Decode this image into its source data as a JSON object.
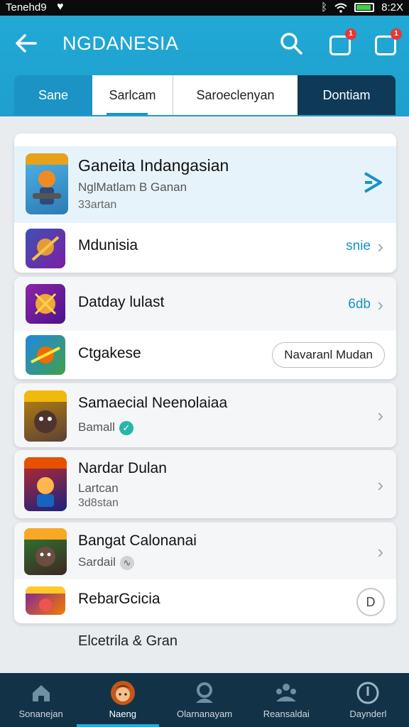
{
  "status_bar": {
    "carrier": "Tenehd9",
    "time": "8:2X"
  },
  "header": {
    "title": "NGDANESIA",
    "badge1": "1",
    "badge2": "1"
  },
  "tabs": [
    {
      "label": "Sane"
    },
    {
      "label": "Sarlcam"
    },
    {
      "label": "Saroeclenyan"
    },
    {
      "label": "Dontiam"
    }
  ],
  "cards": {
    "c1": {
      "r1": {
        "title": "Ganeita Indangasian",
        "sub": "NglMatlam B Ganan",
        "sub2": "33artan"
      },
      "r2": {
        "title": "Mdunisia",
        "value": "snie"
      }
    },
    "c2": {
      "r1": {
        "title": "Datday lulast",
        "value": "6db"
      },
      "r2": {
        "title": "Ctgakese",
        "button": "Navaranl Mudan"
      }
    },
    "c3": {
      "r1": {
        "title": "Samaecial Neenolaiaa",
        "sub": "Bamall"
      }
    },
    "c4": {
      "r1": {
        "title": "Nardar Dulan",
        "sub": "Lartcan",
        "sub2": "3d8stan"
      }
    },
    "c5": {
      "r1": {
        "title": "Bangat Calonanai",
        "sub": "Sardail"
      },
      "r2": {
        "title": "RebarGcicia"
      }
    }
  },
  "footer_text": "Elcetrila & Gran",
  "bottom_nav": [
    {
      "label": "Sonanejan",
      "icon": "home-icon"
    },
    {
      "label": "Naeng",
      "icon": "avatar-icon"
    },
    {
      "label": "Olarnanayam",
      "icon": "profile-icon"
    },
    {
      "label": "Reansaldai",
      "icon": "group-icon"
    },
    {
      "label": "Daynderl",
      "icon": "info-icon"
    }
  ],
  "colors": {
    "accent": "#1f9fcd",
    "nav_bg": "#123247",
    "tab_dark": "#0e3a58"
  }
}
